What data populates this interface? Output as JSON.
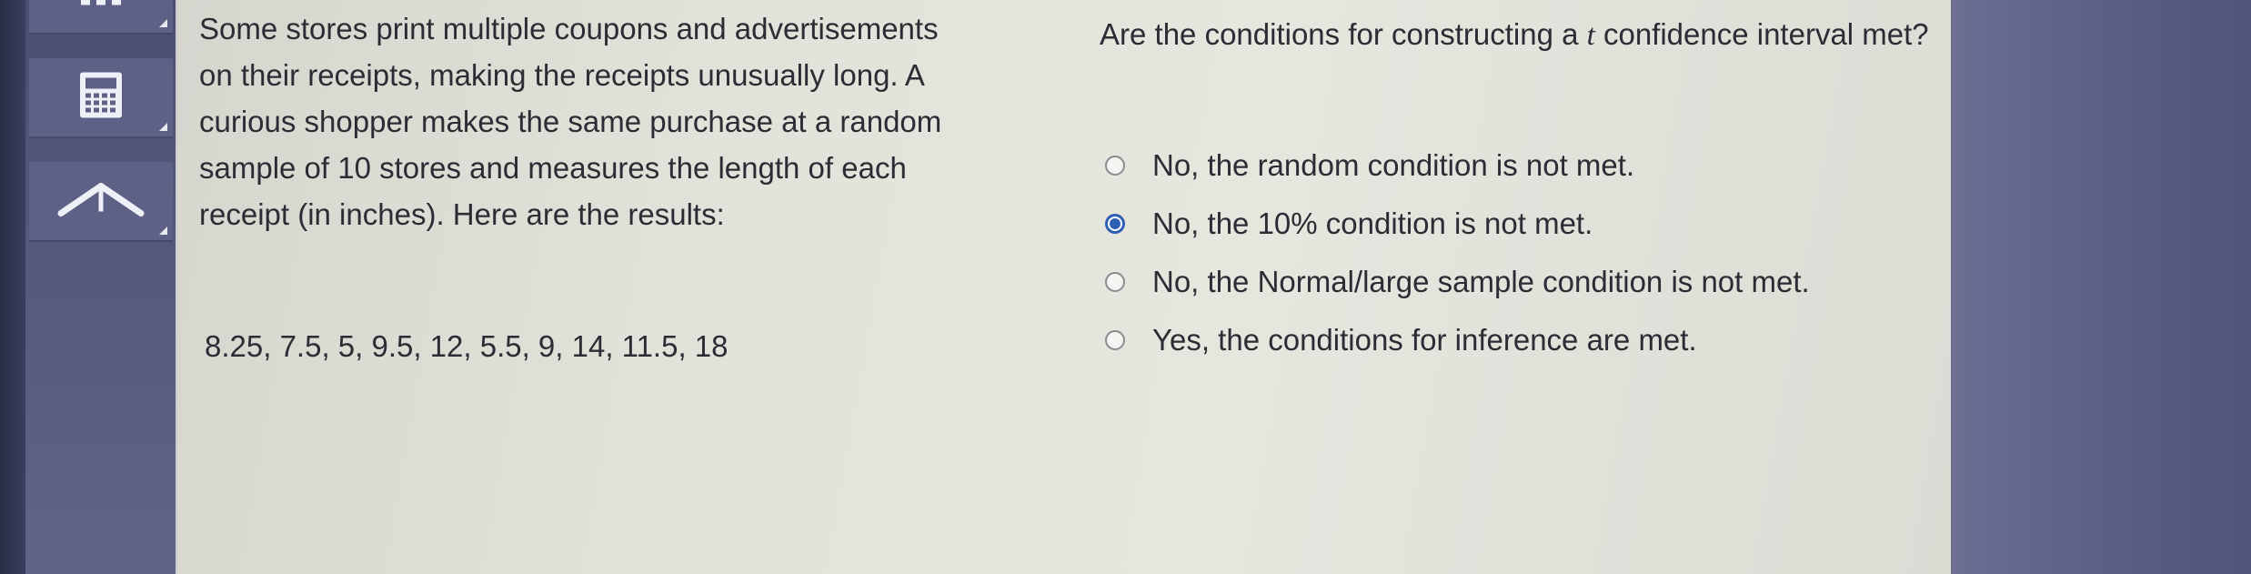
{
  "stem": {
    "lines": [
      "Some stores print multiple coupons and advertisements",
      "on their receipts, making the receipts unusually long. A",
      "curious shopper makes the same purchase at a random",
      "sample of 10 stores and measures the length of each",
      "receipt (in inches). Here are the results:"
    ],
    "data_values": "8.25, 7.5, 5, 9.5, 12, 5.5, 9, 14, 11.5, 18"
  },
  "question": {
    "text_before_t": "Are the conditions for constructing a ",
    "t_symbol": "t",
    "text_after_t": " confidence interval met?"
  },
  "options": [
    {
      "label": "No, the random condition is not met.",
      "selected": false
    },
    {
      "label": "No, the 10% condition is not met.",
      "selected": true
    },
    {
      "label": "No, the Normal/large sample condition is not met.",
      "selected": false
    },
    {
      "label": "Yes, the conditions for inference are met.",
      "selected": false
    }
  ],
  "toolbar": {
    "buttons": [
      {
        "icon": "dots-icon"
      },
      {
        "icon": "calculator-icon"
      },
      {
        "icon": "chevron-up-icon"
      }
    ]
  },
  "colors": {
    "accent": "#2f5fb5",
    "text": "#2c2c34",
    "toolbar": "#5c6185"
  }
}
